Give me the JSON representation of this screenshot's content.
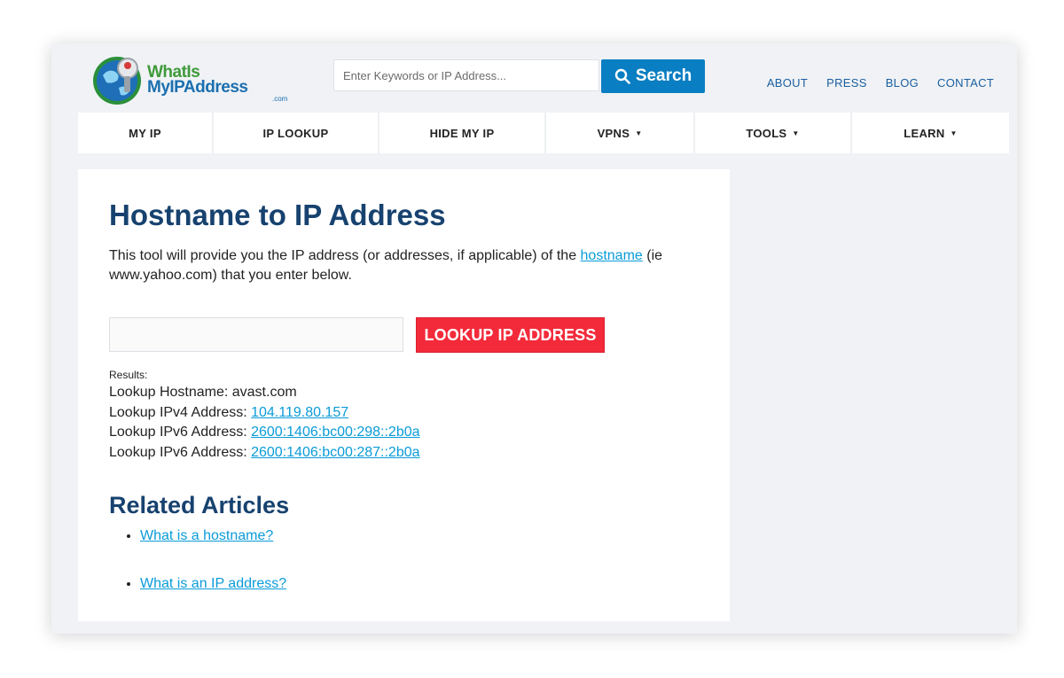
{
  "header": {
    "logo": {
      "line1": "WhatIs",
      "line2": "MyIPAddress",
      "line3": ".com"
    },
    "search": {
      "placeholder": "Enter Keywords or IP Address...",
      "button_label": "Search"
    },
    "links": [
      {
        "label": "ABOUT"
      },
      {
        "label": "PRESS"
      },
      {
        "label": "BLOG"
      },
      {
        "label": "CONTACT"
      }
    ]
  },
  "nav": [
    {
      "label": "MY IP",
      "dropdown": false
    },
    {
      "label": "IP LOOKUP",
      "dropdown": false
    },
    {
      "label": "HIDE MY IP",
      "dropdown": false
    },
    {
      "label": "VPNS",
      "dropdown": true
    },
    {
      "label": "TOOLS",
      "dropdown": true
    },
    {
      "label": "LEARN",
      "dropdown": true
    }
  ],
  "main": {
    "title": "Hostname to IP Address",
    "intro_before": "This tool will provide you the IP address (or addresses, if applicable) of the ",
    "intro_link": "hostname",
    "intro_after": " (ie www.yahoo.com) that you enter below.",
    "input_value": "",
    "lookup_button": "LOOKUP IP ADDRESS",
    "results_label": "Results:",
    "results": {
      "hostname_label": "Lookup Hostname: ",
      "hostname_value": "avast.com",
      "ipv4_label": "Lookup IPv4 Address: ",
      "ipv4_value": "104.119.80.157",
      "ipv6_1_label": "Lookup IPv6 Address: ",
      "ipv6_1_value": "2600:1406:bc00:298::2b0a",
      "ipv6_2_label": "Lookup IPv6 Address: ",
      "ipv6_2_value": "2600:1406:bc00:287::2b0a"
    },
    "related_title": "Related Articles",
    "related": [
      {
        "label": "What is a hostname?"
      },
      {
        "label": "What is an IP address?"
      }
    ]
  },
  "colors": {
    "brand_blue": "#0a7ec2",
    "title_navy": "#17426f",
    "link_blue": "#0a9bd8",
    "lookup_red": "#f32a3a"
  }
}
